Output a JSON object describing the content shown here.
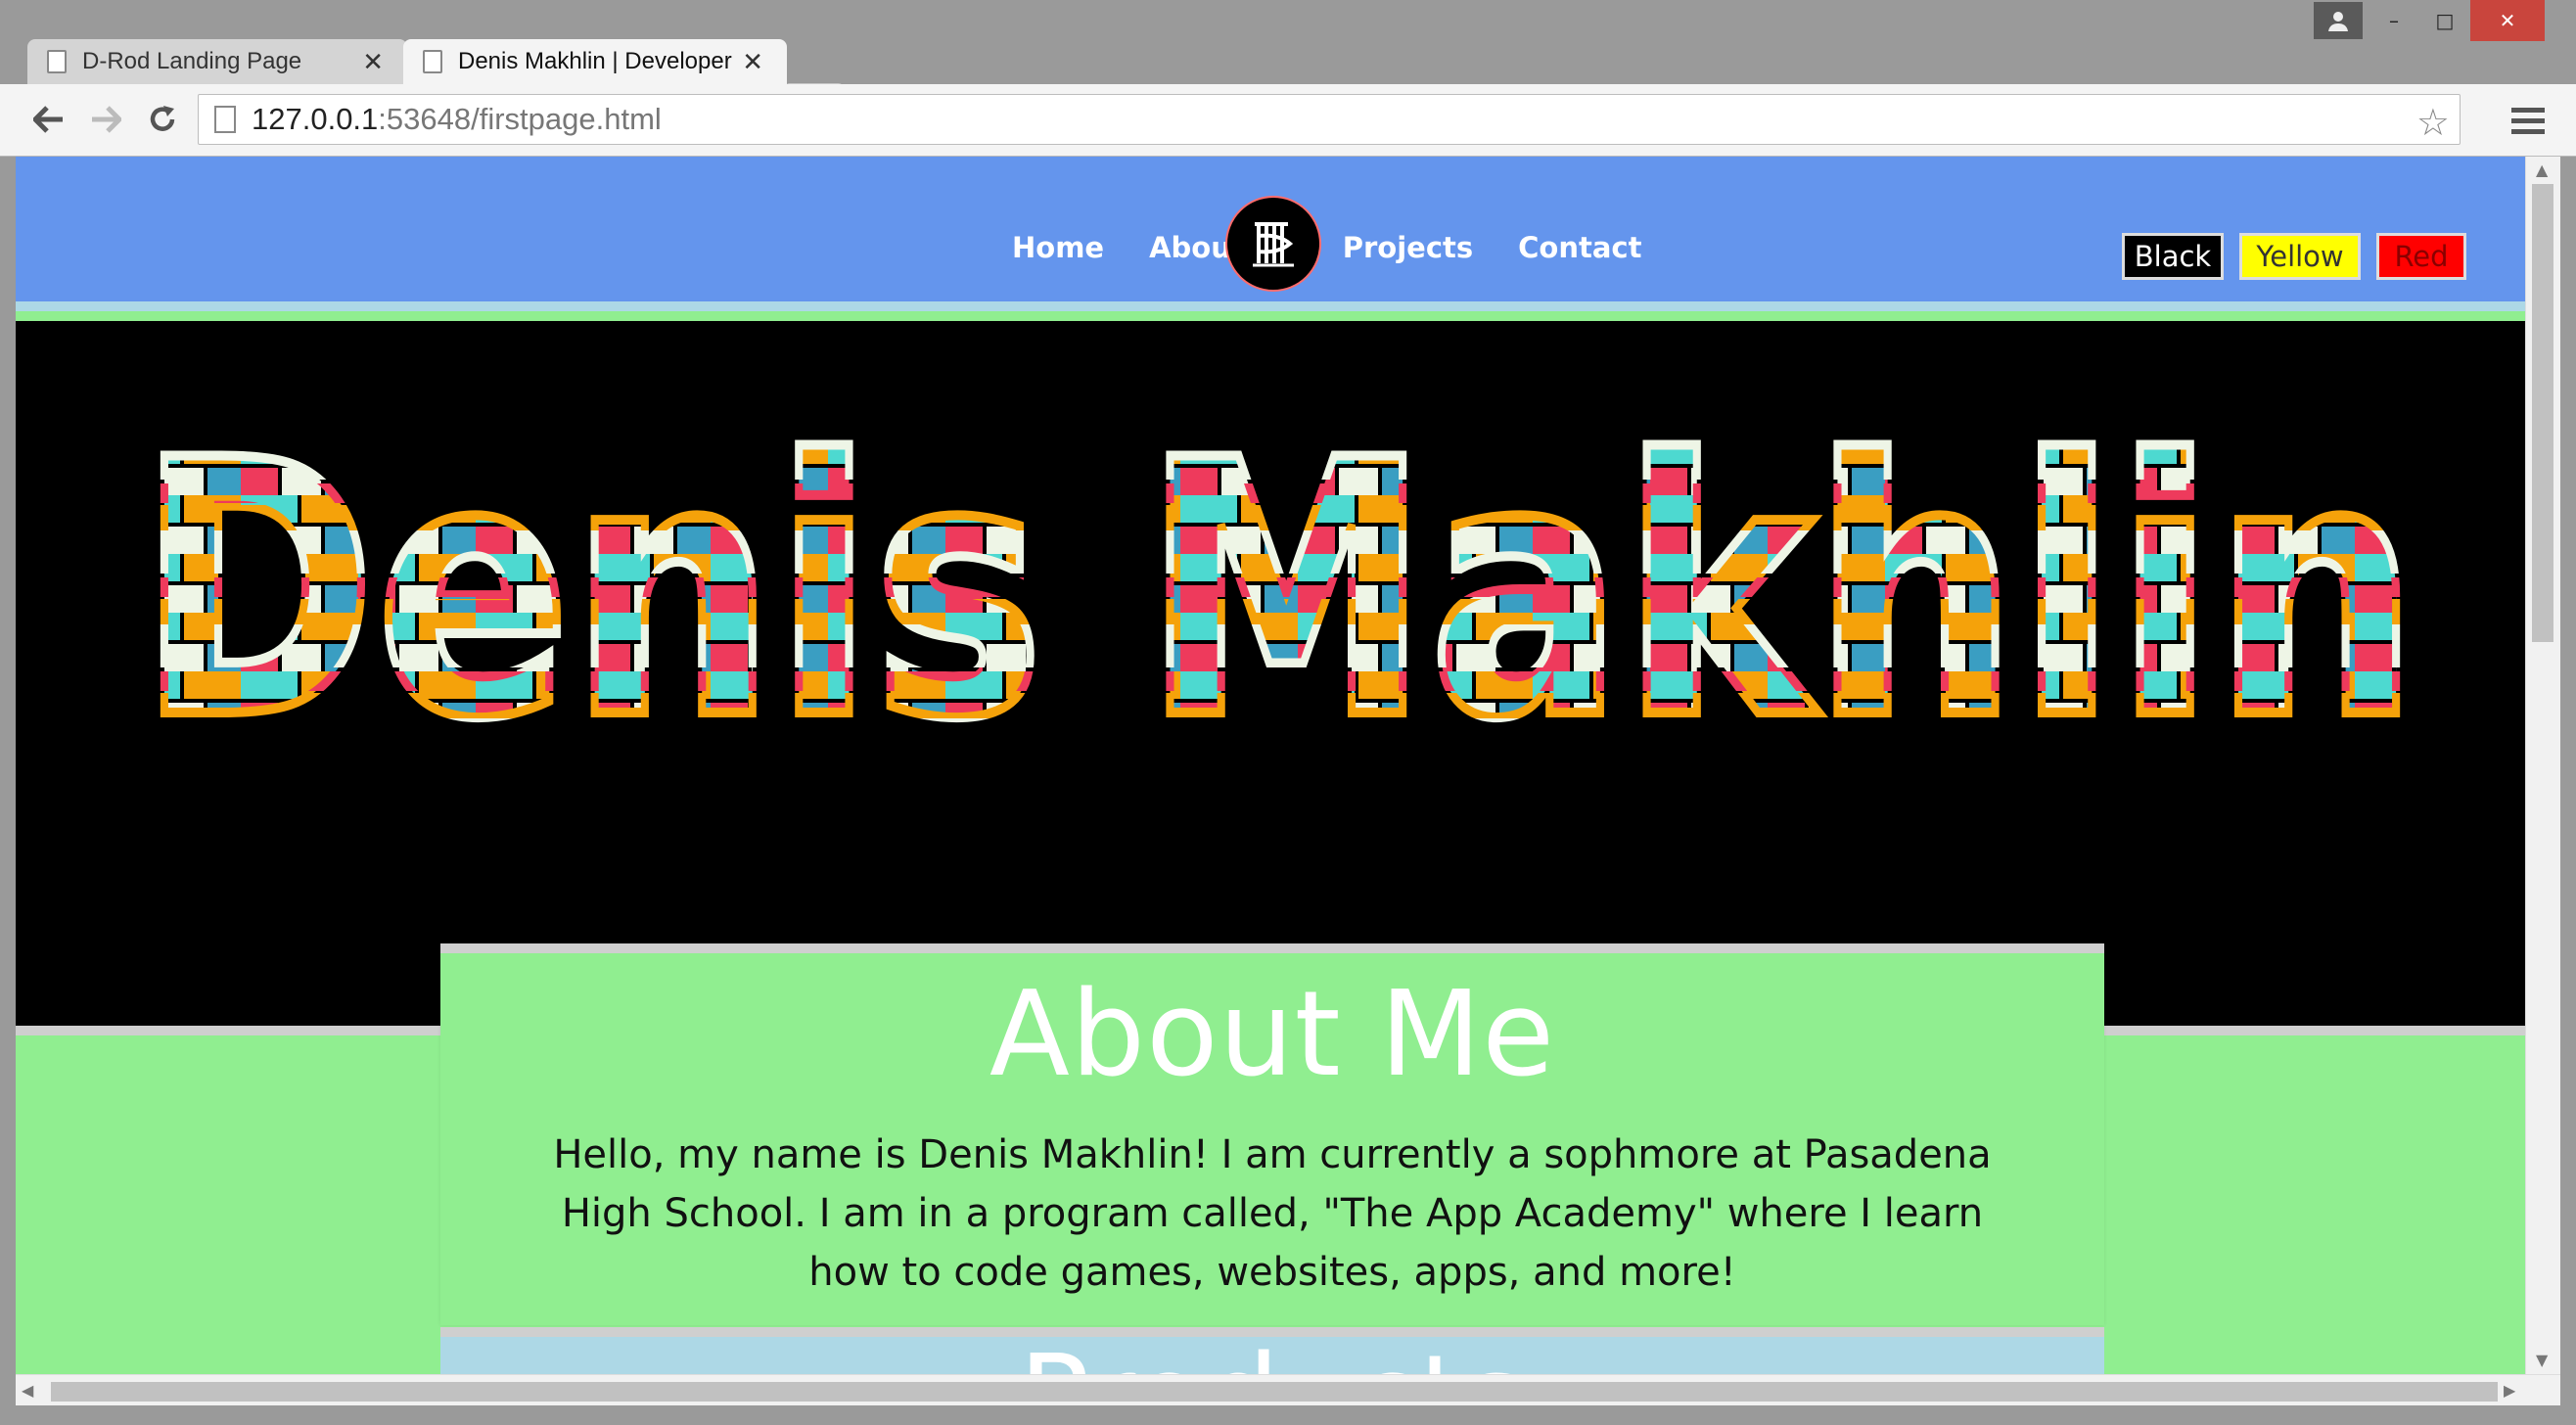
{
  "browser": {
    "tabs": [
      {
        "title": "D-Rod Landing Page",
        "active": false
      },
      {
        "title": "Denis Makhlin | Developer",
        "active": true
      }
    ],
    "url_host": "127.0.0.1",
    "url_rest": ":53648/firstpage.html",
    "icons": {
      "back": "back-arrow-icon",
      "forward": "forward-arrow-icon",
      "reload": "reload-icon",
      "star": "bookmark-star-icon",
      "menu": "hamburger-menu-icon",
      "user": "user-icon"
    }
  },
  "site": {
    "nav": {
      "home": "Home",
      "about": "About",
      "projects": "Projects",
      "contact": "Contact"
    },
    "theme_buttons": {
      "black": "Black",
      "yellow": "Yellow",
      "red": "Red"
    },
    "hero_title": "Denis Makhlin",
    "about": {
      "heading": "About Me",
      "body": "Hello, my name is Denis Makhlin! I am currently a sophmore at Pasadena High School. I am in a program called, \"The App Academy\" where I learn how to code games, websites, apps, and more!"
    },
    "projects_heading": "Products",
    "colors": {
      "nav_bg": "#6495ed",
      "nav_border": "#add8e6",
      "hero_bg": "#000000",
      "page_bg": "#90ee90",
      "projects_bg": "#add8e6"
    },
    "hero_palette": [
      "#4dd9d0",
      "#f5a20a",
      "#ee3a5c",
      "#eef5e6",
      "#3a9ec2"
    ]
  }
}
